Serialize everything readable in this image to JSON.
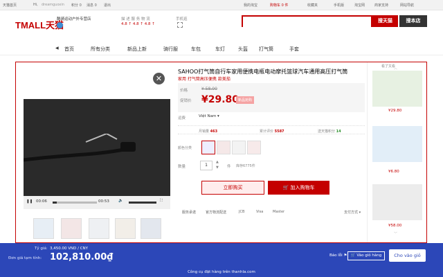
{
  "topbar": {
    "home": "天猫首页",
    "greeting": "Hi,",
    "username": "dreamguoxin",
    "points": "积分 0",
    "messages": "消息 0",
    "logout": "退出",
    "my_taobao": "我的淘宝",
    "cart": "购物车 0 件",
    "favorites": "收藏夹",
    "mobile": "手机版",
    "taobao": "淘宝网",
    "merchant": "商家支持",
    "sitemap": "网站导航"
  },
  "header": {
    "logo": "TMALL天猫",
    "store_name": "酷骑运动户外专营店",
    "ratings_label": "描 述  服 务  物 流",
    "ratings_values": "4.8 ↑  4.8 ↑  4.8 ↑",
    "mobile_label": "手机逛",
    "search_placeholder": "",
    "search_tmall": "搜天猫",
    "search_store": "搜本店"
  },
  "nav": {
    "items": [
      "首页",
      "所有分类",
      "新品上新",
      "骑行服",
      "车包",
      "车灯",
      "头盔",
      "打气筒",
      "手套"
    ]
  },
  "product": {
    "title": "SAHOO打气筒自行车家用便携电瓶电动摩托篮球汽车通用高压打气筒",
    "subtitle": "家用 打气筒高压便携 款美茄",
    "price_label": "价格",
    "old_price": "¥ 58.00",
    "promo_label": "促销价",
    "price": "¥29.80",
    "promo_tag": "新品抢购",
    "ship_label": "运费",
    "ship_to": "Việt Nam ▾",
    "stats": {
      "monthly_label": "月销量",
      "monthly": "463",
      "reviews_label": "累计评价",
      "reviews": "5587",
      "points_label": "送天猫积分",
      "points": "14"
    },
    "color_label": "颜色分类",
    "qty_label": "数量",
    "qty": "1",
    "qty_unit": "件",
    "stock": "库存6775件",
    "buy_now": "立即购买",
    "add_cart": "加入购物车",
    "services": [
      "服务承诺",
      "官方物流配送",
      "JCB",
      "Visa",
      "Master",
      "支付方式 ▾"
    ],
    "video": {
      "time_current": "00:06",
      "time_total": "00:53"
    }
  },
  "sidebar": {
    "title": "看了又看",
    "prices": [
      "¥29.80",
      "¥6.80",
      "¥58.00"
    ]
  },
  "overlay": {
    "rate_label": "Tỷ giá:",
    "rate": "3,450.00 VND / CNY",
    "total_label": "Đơn giá tạm tính:",
    "total": "102,810.00₫",
    "report": "Báo lỗi",
    "cart": "Vào giỏ hàng",
    "add": "Cho vào giỏ",
    "footer": "Công cụ đặt hàng trên thanhla.com"
  },
  "colors": {
    "brand": "#c40000",
    "overlay": "#2c47b8"
  }
}
